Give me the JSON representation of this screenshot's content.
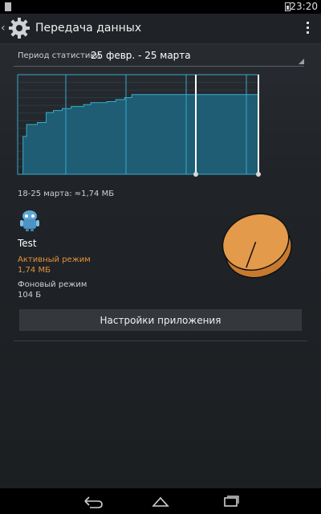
{
  "status_bar": {
    "time": "23:20"
  },
  "action_bar": {
    "title": "Передача данных"
  },
  "period": {
    "label": "Период статистики",
    "value": "25 февр. - 25 марта"
  },
  "chart_data": {
    "type": "area",
    "title": "",
    "xlabel": "",
    "ylabel": "",
    "y_max": 1.0,
    "step_values": [
      0.0,
      0.0,
      0.0,
      0.38,
      0.38,
      0.5,
      0.5,
      0.5,
      0.5,
      0.5,
      0.5,
      0.52,
      0.52,
      0.52,
      0.52,
      0.52,
      0.62,
      0.62,
      0.62,
      0.62,
      0.64,
      0.64,
      0.64,
      0.64,
      0.64,
      0.66,
      0.66,
      0.66,
      0.66,
      0.66,
      0.68,
      0.68,
      0.68,
      0.68,
      0.68,
      0.68,
      0.68,
      0.7,
      0.7,
      0.7,
      0.7,
      0.72,
      0.72,
      0.72,
      0.72,
      0.72,
      0.72,
      0.72,
      0.72,
      0.72,
      0.73,
      0.73,
      0.73,
      0.73,
      0.73,
      0.75,
      0.75,
      0.75,
      0.75,
      0.75,
      0.77,
      0.77,
      0.77,
      0.77,
      0.8,
      0.8,
      0.8,
      0.8,
      0.8,
      0.8,
      0.8,
      0.8,
      0.8,
      0.8,
      0.8,
      0.8,
      0.8,
      0.8,
      0.8,
      0.8,
      0.8,
      0.8,
      0.8,
      0.8,
      0.8,
      0.8,
      0.8,
      0.8,
      0.8,
      0.8,
      0.8,
      0.8,
      0.8,
      0.8,
      0.8,
      0.8,
      0.8,
      0.8,
      0.8,
      0.8,
      0.8,
      0.8,
      0.8,
      0.8,
      0.8,
      0.8,
      0.8,
      0.8,
      0.8,
      0.8,
      0.8,
      0.8,
      0.8,
      0.8,
      0.8,
      0.8,
      0.8,
      0.8,
      0.8,
      0.8,
      0.8,
      0.8,
      0.8,
      0.8,
      0.8,
      0.8,
      0.8,
      0.8,
      0.8,
      0.8,
      0.8,
      0.8,
      0.8,
      0.8,
      0.8
    ],
    "selection_start": 0.74,
    "selection_end": 1.0,
    "colors": {
      "fill": "#1e5d74",
      "stroke": "#36aecd",
      "grid": "#3ba7c9",
      "selection": "#ffffff"
    }
  },
  "usage": {
    "range_label": "18-25 марта: ≈1,74 МБ",
    "app_name": "Test",
    "foreground_label": "Активный режим",
    "foreground_value": "1,74 МБ",
    "background_label": "Фоновый режим",
    "background_value": "104 Б",
    "foreground_fraction": 0.9999,
    "pie_color": "#e39a4a"
  },
  "buttons": {
    "app_settings": "Настройки приложения"
  },
  "nav_bar": {
    "back": "back-icon",
    "home": "home-icon",
    "recent": "recent-apps-icon"
  }
}
